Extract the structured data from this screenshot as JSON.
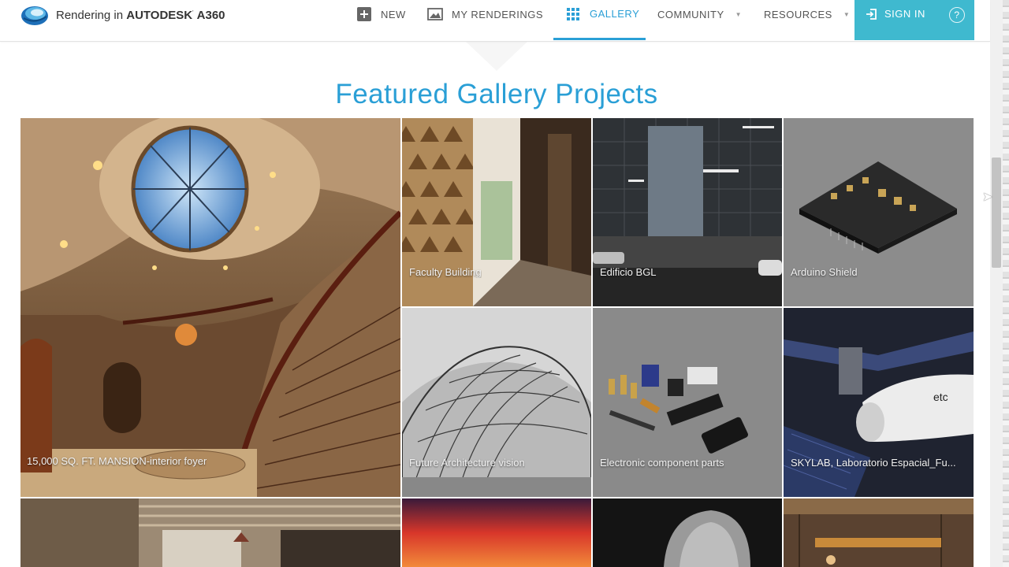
{
  "header": {
    "brand_prefix": "Rendering in ",
    "brand_name": "AUTODESK",
    "brand_product": "A360",
    "logo_icon": "a360-logo-icon",
    "nav": [
      {
        "label": "NEW",
        "icon": "plus-square-icon"
      },
      {
        "label": "MY RENDERINGS",
        "icon": "image-icon"
      },
      {
        "label": "GALLERY",
        "icon": "grid-icon",
        "active": true
      },
      {
        "label": "COMMUNITY",
        "icon": "chevron-down-icon"
      },
      {
        "label": "RESOURCES",
        "icon": "chevron-down-icon"
      }
    ],
    "signin_label": "SIGN IN",
    "help_label": "?"
  },
  "gallery": {
    "title": "Featured Gallery Projects",
    "items": [
      {
        "caption": "15,000 SQ. FT. MANSION-interior foyer"
      },
      {
        "caption": "Faculty Building"
      },
      {
        "caption": "Edificio BGL"
      },
      {
        "caption": "Arduino Shield"
      },
      {
        "caption": "Future Architecture vision"
      },
      {
        "caption": "Electronic component parts"
      },
      {
        "caption": "SKYLAB, Laboratorio Espacial_Fu..."
      },
      {
        "caption": ""
      },
      {
        "caption": ""
      },
      {
        "caption": ""
      },
      {
        "caption": ""
      }
    ]
  },
  "colors": {
    "accent": "#2a9fd6",
    "signin_bg": "#3fb9cf"
  }
}
